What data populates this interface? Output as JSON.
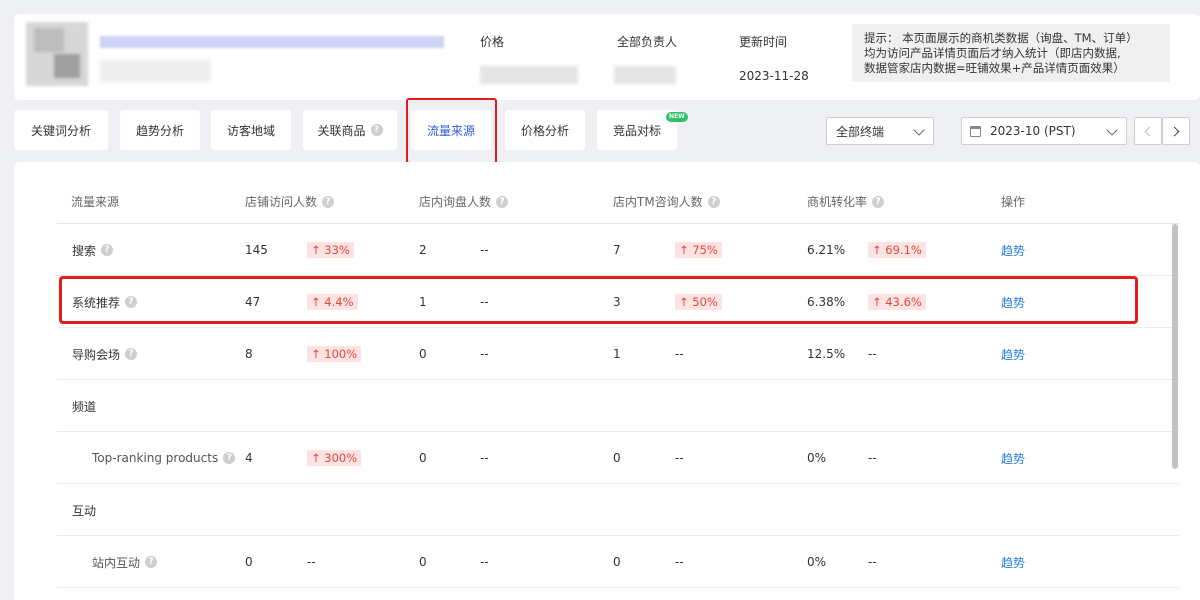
{
  "header": {
    "meta": [
      {
        "label": "价格"
      },
      {
        "label": "全部负责人"
      },
      {
        "label": "更新时间",
        "value": "2023-11-28"
      }
    ],
    "tip_lines": [
      "提示： 本页面展示的商机类数据（询盘、TM、订单）",
      "均为访问产品详情页面后才纳入统计（即店内数据,",
      "数据管家店内数据=旺铺效果+产品详情页面效果）"
    ]
  },
  "tabs": [
    {
      "label": "关键词分析"
    },
    {
      "label": "趋势分析"
    },
    {
      "label": "访客地域"
    },
    {
      "label": "关联商品"
    },
    {
      "label": "流量来源"
    },
    {
      "label": "价格分析"
    },
    {
      "label": "竞品对标"
    }
  ],
  "new_badge": "NEW",
  "filters": {
    "terminal": "全部终端",
    "date": "2023-10 (PST)"
  },
  "table": {
    "headers": [
      "流量来源",
      "店铺访问人数",
      "店内询盘人数",
      "店内TM咨询人数",
      "商机转化率",
      "操作"
    ],
    "rows": [
      {
        "name": "搜索",
        "visitors": "145",
        "visitors_change": "↑ 33%",
        "inquiry": "2",
        "inquiry_change": "--",
        "tm": "7",
        "tm_change": "↑ 75%",
        "rate": "6.21%",
        "rate_change": "↑ 69.1%",
        "action": "趋势"
      },
      {
        "name": "系统推荐",
        "visitors": "47",
        "visitors_change": "↑ 4.4%",
        "inquiry": "1",
        "inquiry_change": "--",
        "tm": "3",
        "tm_change": "↑ 50%",
        "rate": "6.38%",
        "rate_change": "↑ 43.6%",
        "action": "趋势"
      },
      {
        "name": "导购会场",
        "visitors": "8",
        "visitors_change": "↑ 100%",
        "inquiry": "0",
        "inquiry_change": "--",
        "tm": "1",
        "tm_change": "--",
        "rate": "12.5%",
        "rate_change": "--",
        "action": "趋势"
      },
      {
        "name": "频道"
      },
      {
        "name": "Top-ranking products",
        "visitors": "4",
        "visitors_change": "↑ 300%",
        "inquiry": "0",
        "inquiry_change": "--",
        "tm": "0",
        "tm_change": "--",
        "rate": "0%",
        "rate_change": "--",
        "action": "趋势"
      },
      {
        "name": "互动"
      },
      {
        "name": "站内互动",
        "visitors": "0",
        "visitors_change": "--",
        "inquiry": "0",
        "inquiry_change": "--",
        "tm": "0",
        "tm_change": "--",
        "rate": "0%",
        "rate_change": "--",
        "action": "趋势"
      }
    ]
  }
}
